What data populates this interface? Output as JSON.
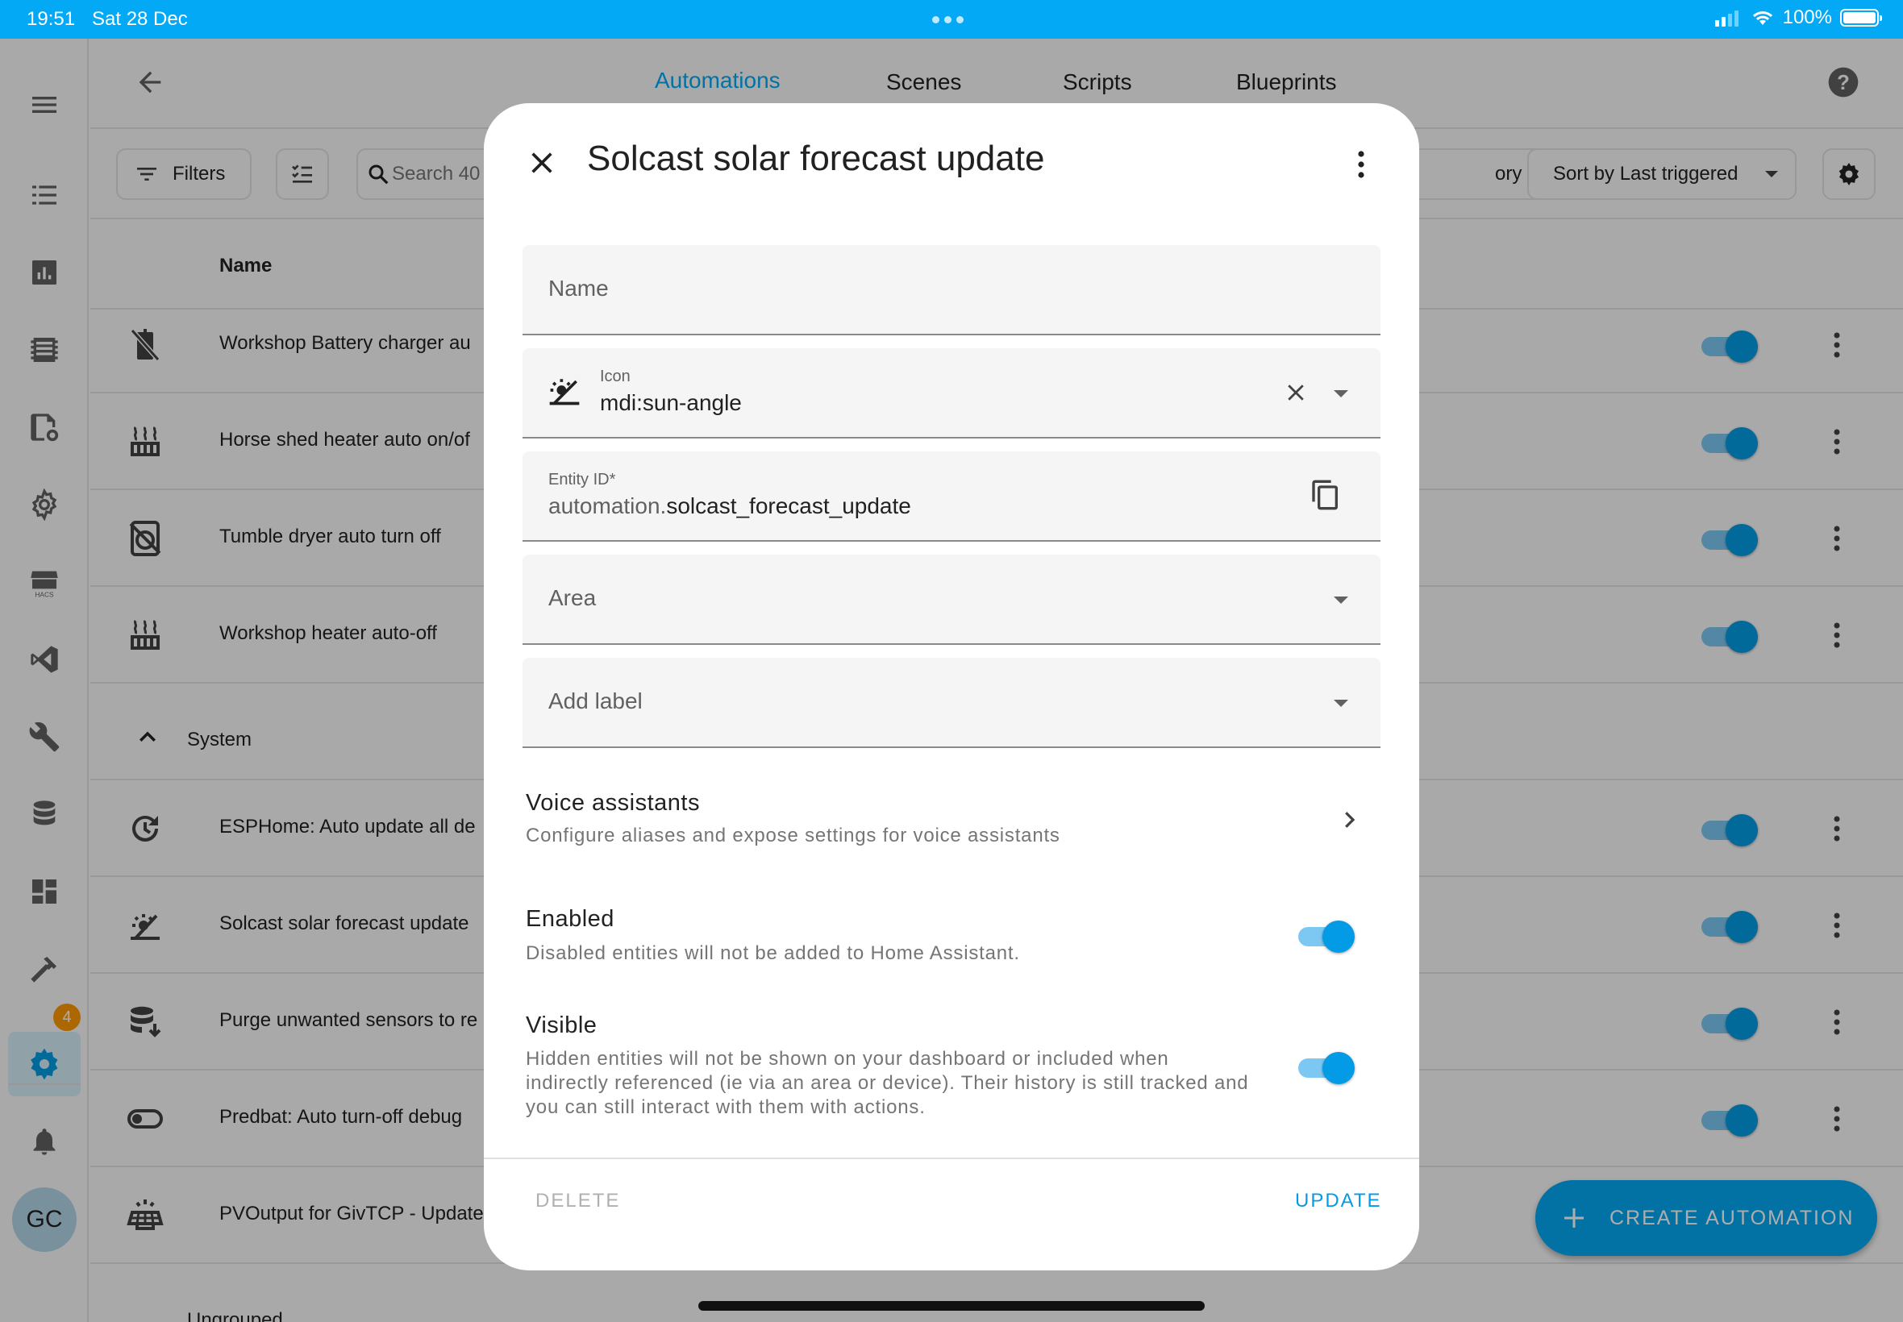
{
  "status_bar": {
    "time": "19:51",
    "date": "Sat 28 Dec",
    "battery": "100%"
  },
  "tabs": [
    {
      "label": "Automations",
      "active": true
    },
    {
      "label": "Scenes",
      "active": false
    },
    {
      "label": "Scripts",
      "active": false
    },
    {
      "label": "Blueprints",
      "active": false
    }
  ],
  "toolbar": {
    "filters_label": "Filters",
    "search_placeholder": "Search 40",
    "group_by_fragment": "ory",
    "sort_label": "Sort by Last triggered"
  },
  "table": {
    "name_header": "Name",
    "rows_top": [
      {
        "label": "Workshop Battery charger au",
        "icon": "battery-off-icon"
      },
      {
        "label": "Horse shed heater auto on/of",
        "icon": "radiator-icon"
      },
      {
        "label": "Tumble dryer auto turn off",
        "icon": "tumble-dryer-off-icon"
      },
      {
        "label": "Workshop heater auto-off",
        "icon": "radiator-icon"
      }
    ],
    "group_label": "System",
    "rows_system": [
      {
        "label": "ESPHome: Auto update all de",
        "icon": "update-icon"
      },
      {
        "label": "Solcast solar forecast update",
        "icon": "sun-angle-icon"
      },
      {
        "label": "Purge unwanted sensors to re",
        "icon": "database-arrow-down-icon"
      },
      {
        "label": "Predbat: Auto turn-off debug",
        "icon": "toggle-switch-off-icon"
      },
      {
        "label": "PVOutput for GivTCP - Update",
        "icon": "solar-power-icon"
      }
    ],
    "next_group_label": "Ungrouped"
  },
  "sidebar": {
    "badge": "4",
    "avatar": "GC"
  },
  "fab_label": "CREATE AUTOMATION",
  "dialog": {
    "title": "Solcast solar forecast update",
    "name_label": "Name",
    "icon_label": "Icon",
    "icon_value": "mdi:sun-angle",
    "entity_id_label": "Entity ID*",
    "entity_id_prefix": "automation.",
    "entity_id_value": "solcast_forecast_update",
    "area_label": "Area",
    "add_label": "Add label",
    "voice_title": "Voice assistants",
    "voice_sub": "Configure aliases and expose settings for voice assistants",
    "enabled_title": "Enabled",
    "enabled_sub": "Disabled entities will not be added to Home Assistant.",
    "enabled_on": true,
    "visible_title": "Visible",
    "visible_sub": "Hidden entities will not be shown on your dashboard or included when indirectly referenced (ie via an area or device). Their history is still tracked and you can still interact with them with actions.",
    "visible_on": true,
    "delete_label": "DELETE",
    "update_label": "UPDATE"
  },
  "colors": {
    "accent": "#03a9f4",
    "switch_on": "#039be5",
    "badge": "#ff9800"
  }
}
